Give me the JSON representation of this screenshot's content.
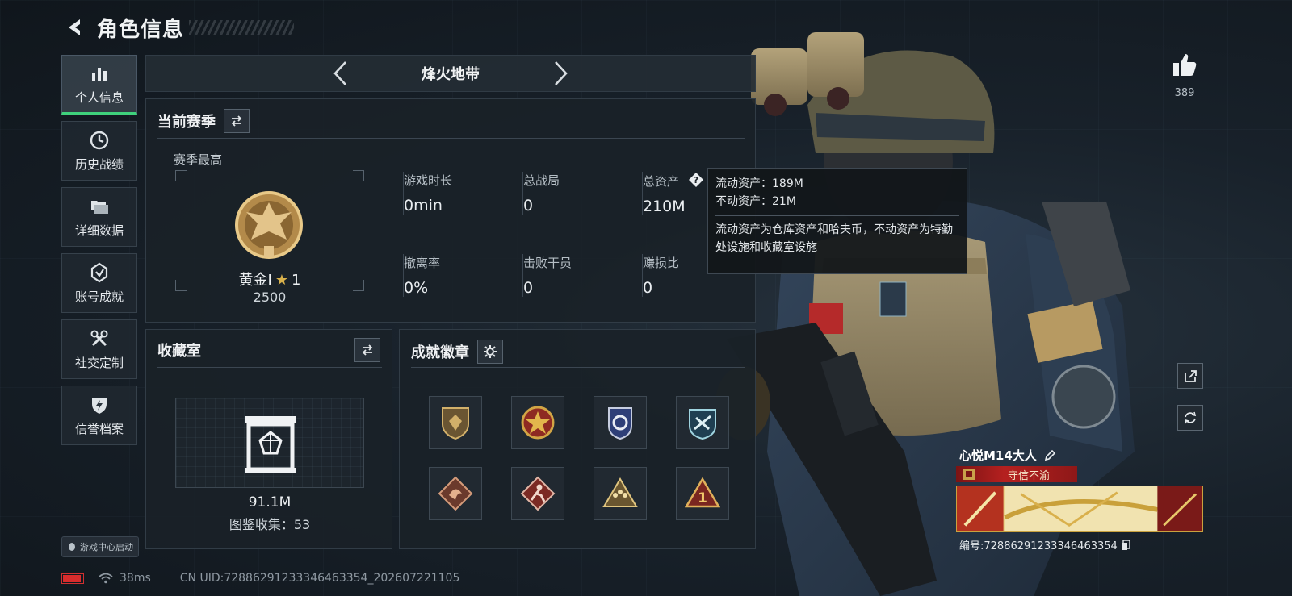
{
  "header": {
    "title": "角色信息"
  },
  "sidebar": {
    "items": [
      {
        "label": "个人信息",
        "icon": "bar-chart-icon",
        "active": true
      },
      {
        "label": "历史战绩",
        "icon": "clock-icon",
        "active": false
      },
      {
        "label": "详细数据",
        "icon": "folders-icon",
        "active": false
      },
      {
        "label": "账号成就",
        "icon": "achievement-icon",
        "active": false
      },
      {
        "label": "社交定制",
        "icon": "tools-icon",
        "active": false
      },
      {
        "label": "信誉档案",
        "icon": "shield-bolt-icon",
        "active": false
      }
    ],
    "launch_label": "游戏中心启动"
  },
  "mode": {
    "title": "烽火地带"
  },
  "season": {
    "title": "当前赛季",
    "best_label": "赛季最高",
    "rank_name": "黄金I",
    "rank_stars": "1",
    "rank_score": "2500",
    "stats": [
      {
        "label": "游戏时长",
        "value": "0min"
      },
      {
        "label": "总战局",
        "value": "0"
      },
      {
        "label": "总资产",
        "value": "210M"
      },
      {
        "label": "撤离率",
        "value": "0%"
      },
      {
        "label": "击败干员",
        "value": "0"
      },
      {
        "label": "赚损比",
        "value": "0"
      }
    ]
  },
  "tooltip": {
    "liquid": "流动资产：189M",
    "fixed": "不动资产：21M",
    "desc": "流动资产为仓库资产和哈夫币，不动资产为特勤处设施和收藏室设施"
  },
  "collection": {
    "title": "收藏室",
    "value": "91.1M",
    "count": "图鉴收集：53"
  },
  "badges": {
    "title": "成就徽章"
  },
  "likes": {
    "count": "389"
  },
  "player": {
    "name": "心悦M14大人",
    "title": "守信不渝",
    "id_label": "编号:7288629123334646335​4"
  },
  "status": {
    "ping": "38ms",
    "uid": "CN UID:72886291233346463354_202607221105",
    "battery_level": 0.9
  },
  "colors": {
    "accent": "#3fd17c",
    "gold": "#d9b24c",
    "title_red": "#b5201f"
  }
}
